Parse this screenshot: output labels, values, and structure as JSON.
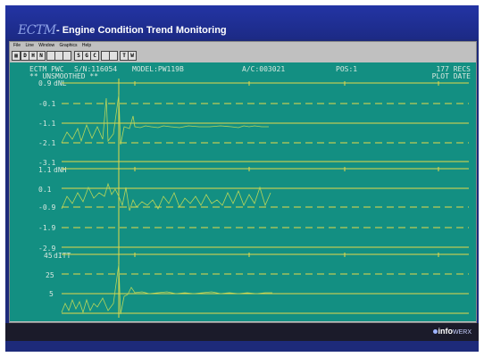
{
  "slide": {
    "logo": "ECTM",
    "title": "- Engine Condition Trend Monitoring",
    "brand": {
      "main": "info",
      "sub": "WERX"
    }
  },
  "menu": [
    "File",
    "Line",
    "Window",
    "Graphics",
    "Help"
  ],
  "toolbar": [
    "",
    "D",
    "H",
    "N",
    "",
    "",
    "",
    "S",
    "G",
    "C",
    "",
    "",
    "",
    "T",
    "W"
  ],
  "terminal": {
    "header_line1": {
      "program": "ECTM PWC",
      "serial": "S/N:116054",
      "model": "MODEL:PW119B",
      "aircraft": "A/C:003021",
      "position": "POS:1",
      "records": "177 RECS"
    },
    "header_line2": {
      "mode": "** UNSMOOTHED **",
      "plot_mode": "PLOT DATE"
    }
  },
  "panels": [
    {
      "name": "dNL",
      "ticks": [
        "0.9",
        "-0.1",
        "-1.1",
        "-2.1",
        "-3.1"
      ]
    },
    {
      "name": "dNH",
      "ticks": [
        "1.1",
        "0.1",
        "-0.9",
        "-1.9",
        "-2.9"
      ]
    },
    {
      "name": "dITT",
      "ticks": [
        "45",
        "25",
        "5"
      ]
    }
  ],
  "colors": {
    "terminal_bg": "#138f82",
    "gridline": "#e6d94a",
    "trace": "#b9d65a",
    "text": "#d8e8e0"
  }
}
